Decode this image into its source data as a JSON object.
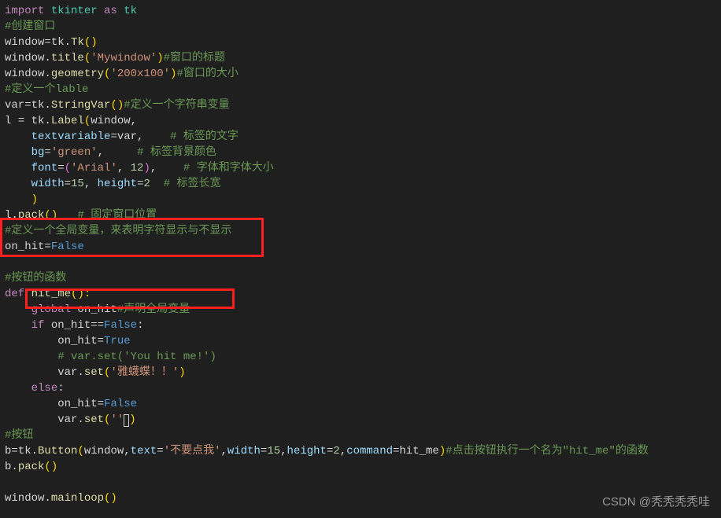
{
  "code": {
    "l1": {
      "t1": "import",
      "t2": " tkinter ",
      "t3": "as",
      "t4": " tk"
    },
    "l2": {
      "c": "#创建窗口"
    },
    "l3": {
      "a": "window",
      "b": "=",
      "c": "tk.",
      "d": "Tk",
      "e": "()"
    },
    "l4": {
      "a": "window.",
      "b": "title",
      "c": "(",
      "d": "'Mywindow'",
      "e": ")",
      "f": "#窗口的标题"
    },
    "l5": {
      "a": "window.",
      "b": "geometry",
      "c": "(",
      "d": "'200x100'",
      "e": ")",
      "f": "#窗口的大小"
    },
    "l6": {
      "c": "#定义一个lable"
    },
    "l7": {
      "a": "var",
      "b": "=",
      "c": "tk.",
      "d": "StringVar",
      "e": "()",
      "f": "#定义一个字符串变量"
    },
    "l8": {
      "a": "l ",
      "b": "= ",
      "c": "tk.",
      "d": "Label",
      "e": "(",
      "f": "window,"
    },
    "l9": {
      "a": "    ",
      "b": "textvariable",
      "c": "=",
      "d": "var,    ",
      "e": "# 标签的文字"
    },
    "l10": {
      "a": "    ",
      "b": "bg",
      "c": "=",
      "d": "'green'",
      "e": ",     ",
      "f": "# 标签背景颜色"
    },
    "l11": {
      "a": "    ",
      "b": "font",
      "c": "=",
      "d": "(",
      "e": "'Arial'",
      "f": ", ",
      "g": "12",
      "h": ")",
      "i": ",    ",
      "j": "# 字体和字体大小"
    },
    "l12": {
      "a": "    ",
      "b": "width",
      "c": "=",
      "d": "15",
      "e": ", ",
      "f": "height",
      "g": "=",
      "h": "2",
      "i": "  ",
      "j": "# 标签长宽"
    },
    "l13": {
      "a": "    ",
      "b": ")"
    },
    "l14": {
      "a": "l.",
      "b": "pack",
      "c": "()",
      "d": "   ",
      "e": "# 固定窗口位置"
    },
    "l15": {
      "c": "#定义一个全局变量，来表明字符显示与不显示"
    },
    "l16": {
      "a": "on_hit",
      "b": "=",
      "c": "False"
    },
    "l17": {
      "blank": " "
    },
    "l18": {
      "c": "#按钮的函数"
    },
    "l19": {
      "a": "def",
      "b": " ",
      "c": "hit_me",
      "d": "():"
    },
    "l20": {
      "a": "    ",
      "b": "global",
      "c": " on_hit",
      "d": "#声明全局变量"
    },
    "l21": {
      "a": "    ",
      "b": "if",
      "c": " on_hit",
      "d": "==",
      "e": "False",
      "f": ":"
    },
    "l22": {
      "a": "        on_hit",
      "b": "=",
      "c": "True"
    },
    "l23": {
      "a": "        ",
      "b": "# var.set('You hit me!')"
    },
    "l24": {
      "a": "        var.",
      "b": "set",
      "c": "(",
      "d": "'雅蠛蝶！！'",
      "e": ")"
    },
    "l25": {
      "a": "    ",
      "b": "else",
      "c": ":"
    },
    "l26": {
      "a": "        on_hit",
      "b": "=",
      "c": "False"
    },
    "l27": {
      "a": "        var.",
      "b": "set",
      "c": "(",
      "d": "''",
      "e": ")"
    },
    "l28": {
      "c": "#按钮"
    },
    "l29": {
      "a": "b",
      "b": "=",
      "c": "tk.",
      "d": "Button",
      "e": "(",
      "f": "window,",
      "g": "text",
      "h": "=",
      "i": "'不要点我'",
      "j": ",",
      "k": "width",
      "l": "=",
      "m": "15",
      "n": ",",
      "o": "height",
      "p": "=",
      "q": "2",
      "r": ",",
      "s": "command",
      "t": "=",
      "u": "hit_me",
      "v": ")",
      "w": "#点击按钮执行一个名为\"hit_me\"的函数"
    },
    "l30": {
      "a": "b.",
      "b": "pack",
      "c": "()"
    },
    "l31": {
      "blank": " "
    },
    "l32": {
      "a": "window.",
      "b": "mainloop",
      "c": "()"
    }
  },
  "watermark": "CSDN @秃秃秃秃哇"
}
